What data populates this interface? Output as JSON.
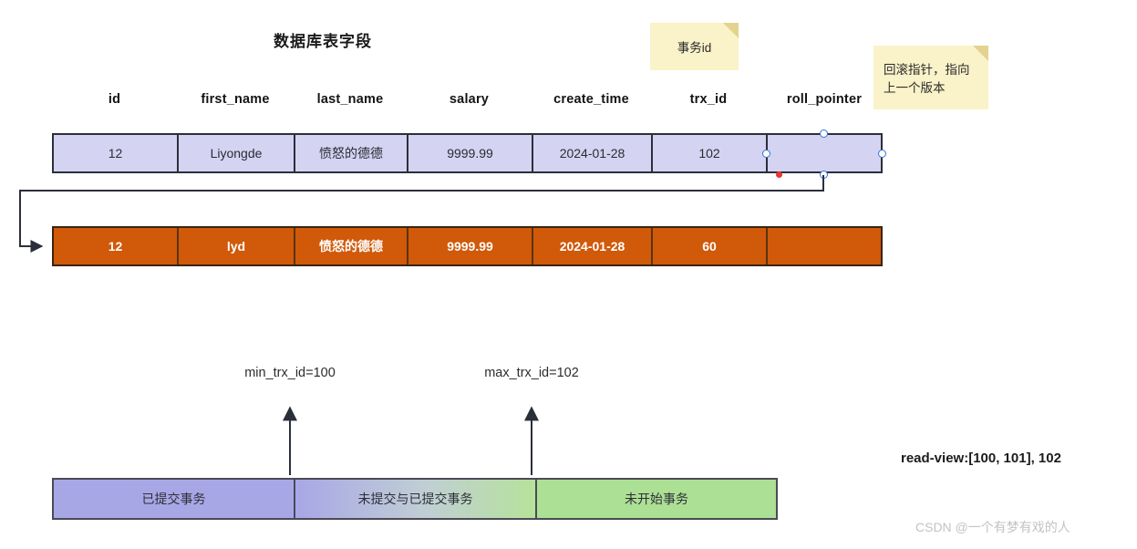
{
  "diagram": {
    "title": "数据库表字段",
    "read_view": "read-view:[100, 101], 102",
    "watermark": "CSDN @一个有梦有戏的人"
  },
  "sticky_notes": [
    {
      "id": "trx-id-note",
      "text": "事务id"
    },
    {
      "id": "roll-pointer-note",
      "text": "回滚指针，指向上一个版本"
    }
  ],
  "table": {
    "columns": [
      {
        "key": "id",
        "label": "id"
      },
      {
        "key": "first_name",
        "label": "first_name"
      },
      {
        "key": "last_name",
        "label": "last_name"
      },
      {
        "key": "salary",
        "label": "salary"
      },
      {
        "key": "create_time",
        "label": "create_time"
      },
      {
        "key": "trx_id",
        "label": "trx_id"
      },
      {
        "key": "roll_pointer",
        "label": "roll_pointer"
      }
    ],
    "rows": [
      {
        "name": "current-version-row",
        "cells": [
          "12",
          "Liyongde",
          "愤怒的德德",
          "9999.99",
          "2024-01-28",
          "102",
          ""
        ]
      },
      {
        "name": "undo-log-row",
        "cells": [
          "12",
          "lyd",
          "愤怒的德德",
          "9999.99",
          "2024-01-28",
          "60",
          ""
        ]
      }
    ]
  },
  "transaction_bar": {
    "segments": [
      {
        "label": "已提交事务",
        "color": "#a8a7e6"
      },
      {
        "label": "未提交与已提交事务",
        "color": "gradient"
      },
      {
        "label": "未开始事务",
        "color": "#ace094"
      }
    ],
    "markers": [
      {
        "label": "min_trx_id=100"
      },
      {
        "label": "max_trx_id=102"
      }
    ]
  },
  "colors": {
    "current_row_fill": "#d4d3f2",
    "undo_row_fill": "#d0590a",
    "sticky_fill": "#faf2c8",
    "committed": "#a8a7e6",
    "not_started": "#ace094",
    "border": "#2b2f3a",
    "handle_stroke": "#2f77d8",
    "red_dot": "#e8372c"
  }
}
